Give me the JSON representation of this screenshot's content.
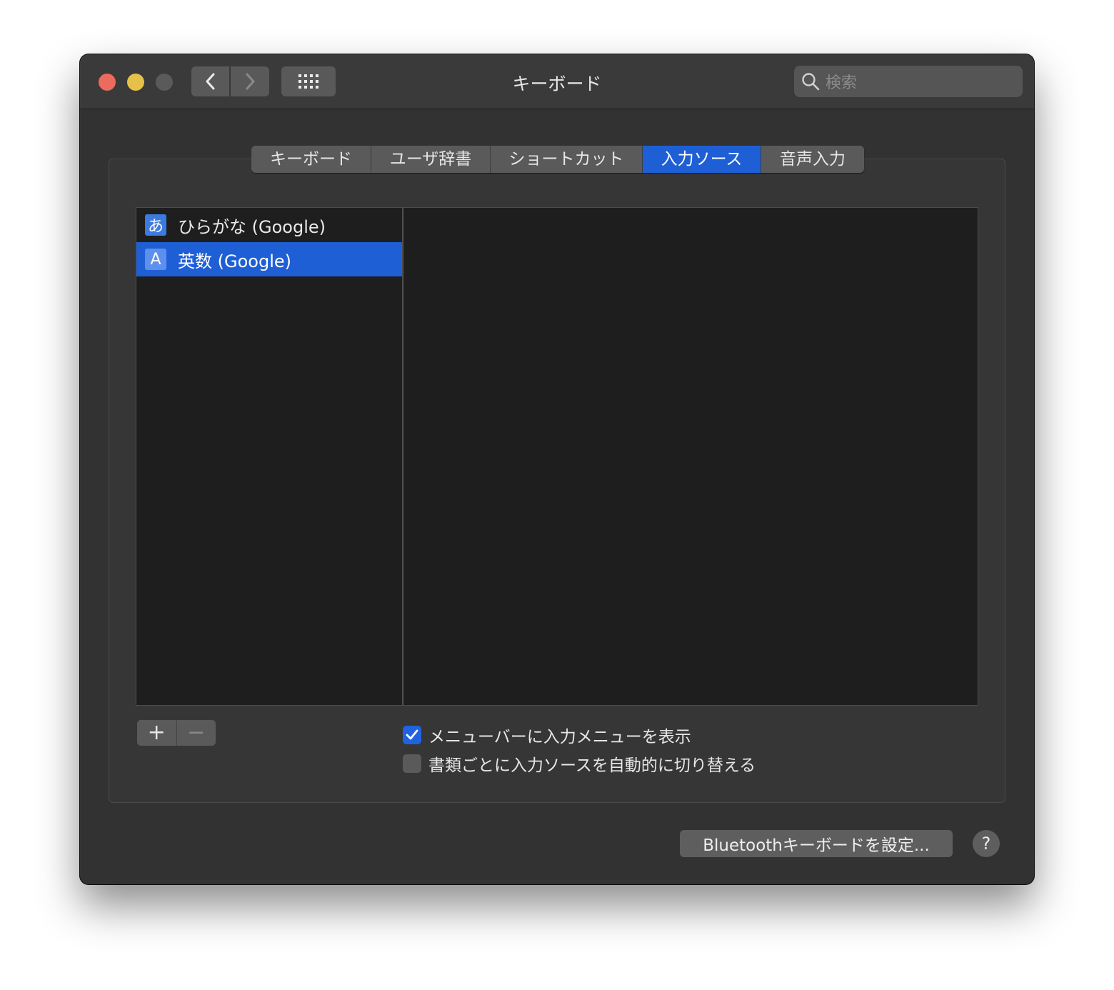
{
  "window": {
    "title": "キーボード"
  },
  "toolbar": {
    "search_placeholder": "検索"
  },
  "tabs": [
    {
      "label": "キーボード",
      "active": false
    },
    {
      "label": "ユーザ辞書",
      "active": false
    },
    {
      "label": "ショートカット",
      "active": false
    },
    {
      "label": "入力ソース",
      "active": true
    },
    {
      "label": "音声入力",
      "active": false
    }
  ],
  "input_sources": [
    {
      "icon_text": "あ",
      "label": "ひらがな (Google)",
      "selected": false
    },
    {
      "icon_text": "A",
      "label": "英数 (Google)",
      "selected": true
    }
  ],
  "list_controls": {
    "add_label": "+",
    "remove_label": "−"
  },
  "options": {
    "show_input_menu": {
      "label": "メニューバーに入力メニューを表示",
      "checked": true
    },
    "auto_switch": {
      "label": "書類ごとに入力ソースを自動的に切り替える",
      "checked": false
    }
  },
  "footer": {
    "bluetooth_label": "Bluetoothキーボードを設定...",
    "help_label": "?"
  },
  "colors": {
    "accent": "#1f5fd6",
    "close": "#ed6a5e",
    "minimize": "#e6c14a"
  }
}
